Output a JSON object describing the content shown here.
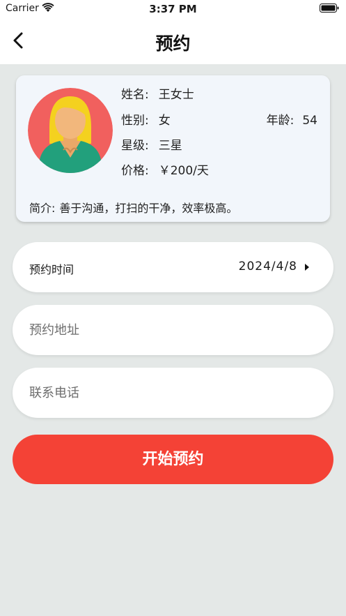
{
  "status_bar": {
    "carrier": "Carrier",
    "time": "3:37 PM"
  },
  "nav": {
    "title": "预约"
  },
  "profile": {
    "name_label": "姓名:",
    "name": "王女士",
    "gender_label": "性别:",
    "gender": "女",
    "age_label": "年龄:",
    "age": "54",
    "level_label": "星级:",
    "level": "三星",
    "price_label": "价格:",
    "price": "￥200/天",
    "intro_label": "简介:",
    "intro": "善于沟通，打扫的干净，效率极高。",
    "avatar_icon": "female-avatar-icon"
  },
  "form": {
    "time_label": "预约时间",
    "time_value": "2024/4/8",
    "address_placeholder": "预约地址",
    "phone_placeholder": "联系电话",
    "submit_label": "开始预约"
  },
  "colors": {
    "accent": "#f44236",
    "background": "#e4e8e7",
    "card": "#f2f6fb",
    "avatar_bg": "#f1605e"
  }
}
